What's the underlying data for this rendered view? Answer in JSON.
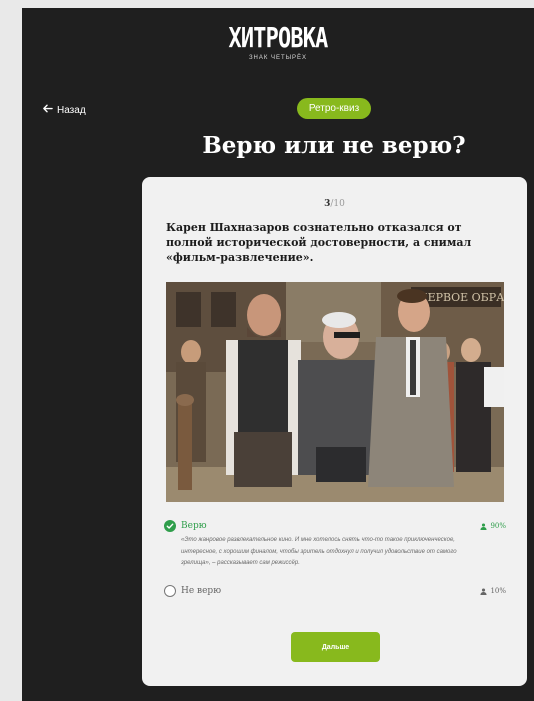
{
  "header": {
    "logo_title": "ХИТРОВКА",
    "logo_subtitle": "ЗНАК ЧЕТЫРЁХ"
  },
  "nav": {
    "back_label": "Назад"
  },
  "badge": "Ретро-квиз",
  "page_title": "Верю или не верю?",
  "quiz": {
    "counter_current": "3",
    "counter_total": "/10",
    "question": "Карен Шахназаров сознательно отказался от полной исторической достоверности, а снимал «фильм-развлечение».",
    "options": [
      {
        "label": "Верю",
        "percent": "90%",
        "selected": true,
        "explanation": "«Это жанровое развлекательное кино. И мне хотелось снять что-то такое приключенческое, интересное, с хорошим финалом, чтобы зритель отдохнул и получил удовольствие от самого зрелища», – рассказывает сам режиссёр."
      },
      {
        "label": "Не верю",
        "percent": "10%",
        "selected": false
      }
    ],
    "next_label": "Дальше"
  },
  "colors": {
    "page_bg": "#1f1f1f",
    "accent_green": "#88b91d",
    "correct_green": "#2f9e4b",
    "card_bg": "#f1f1f1"
  },
  "photo": {
    "sign_text": "ПЕРВОЕ ОБРАЗ"
  }
}
